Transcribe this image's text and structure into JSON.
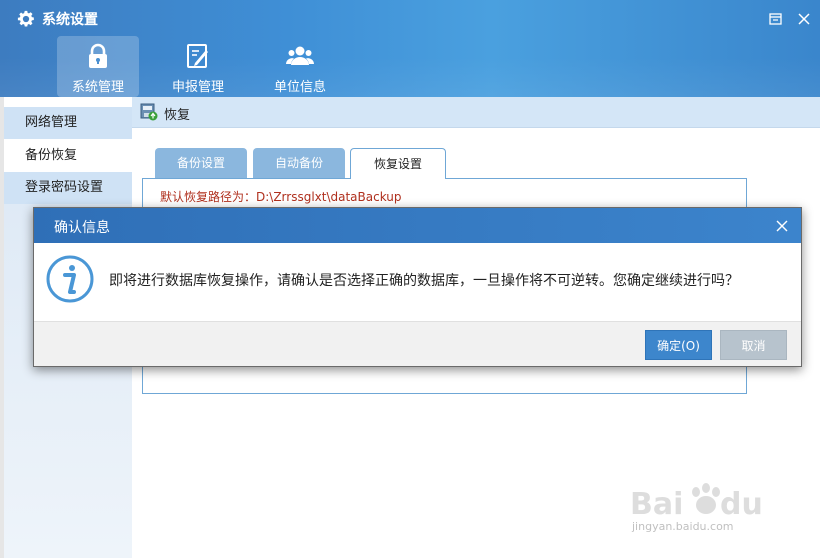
{
  "window": {
    "title": "系统设置"
  },
  "nav": [
    {
      "label": "系统管理",
      "active": true,
      "icon": "lock-icon"
    },
    {
      "label": "申报管理",
      "active": false,
      "icon": "edit-document-icon"
    },
    {
      "label": "单位信息",
      "active": false,
      "icon": "users-icon"
    }
  ],
  "sidebar": {
    "items": [
      {
        "label": "网络管理",
        "active": false
      },
      {
        "label": "备份恢复",
        "active": true
      },
      {
        "label": "登录密码设置",
        "active": false
      }
    ]
  },
  "toolbar": {
    "label": "恢复",
    "icon": "restore-database-icon"
  },
  "tabs": [
    {
      "label": "备份设置",
      "active": false
    },
    {
      "label": "自动备份",
      "active": false
    },
    {
      "label": "恢复设置",
      "active": true
    }
  ],
  "panel": {
    "path_text": "默认恢复路径为：D:\\Zrrssglxt\\dataBackup"
  },
  "dialog": {
    "title": "确认信息",
    "message": "即将进行数据库恢复操作，请确认是否选择正确的数据库，一旦操作将不可逆转。您确定继续进行吗？",
    "ok_label": "确定(O)",
    "cancel_label": "取消",
    "icon": "info-icon"
  },
  "watermark": {
    "text": "jingyan.baidu.com",
    "brand": "Baidu 经验"
  },
  "colors": {
    "header": "#3f8fd6",
    "dialog_header": "#2f6fb7",
    "ok_button": "#3d86cc",
    "cancel_button": "#b7c3cd",
    "path_text": "#b0301e",
    "tab_inactive": "#8bb7de"
  }
}
